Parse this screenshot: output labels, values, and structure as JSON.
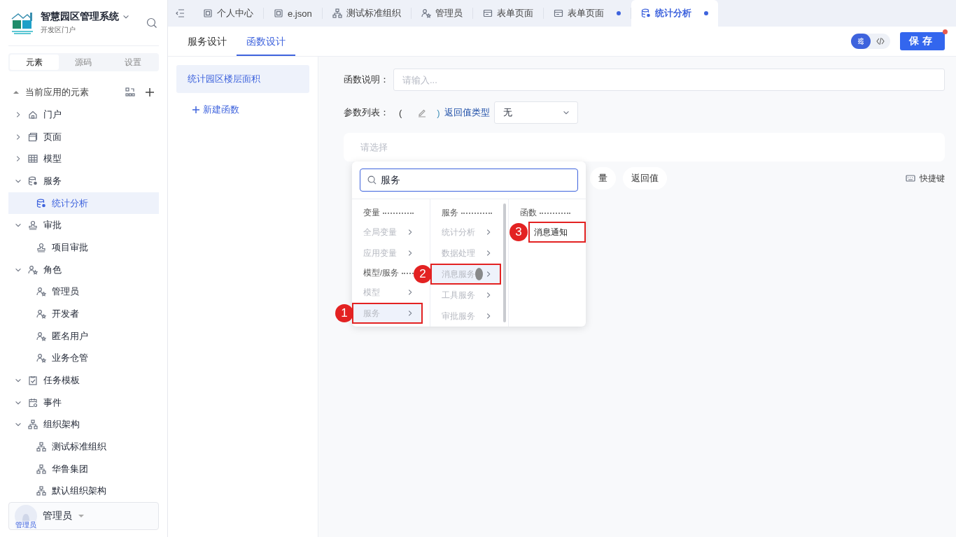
{
  "app": {
    "title": "智慧园区管理系统",
    "subtitle": "开发区门户"
  },
  "sidebar_tabs": [
    {
      "label": "元素",
      "selected": true
    },
    {
      "label": "源码",
      "selected": false
    },
    {
      "label": "设置",
      "selected": false
    }
  ],
  "tree_header": "当前应用的元素",
  "tree": [
    {
      "label": "门户",
      "kind": "home",
      "expanded": false,
      "selected": false
    },
    {
      "label": "页面",
      "kind": "page",
      "expanded": false,
      "selected": false
    },
    {
      "label": "模型",
      "kind": "table",
      "expanded": false,
      "selected": false
    },
    {
      "label": "服务",
      "kind": "service",
      "expanded": true,
      "selected": false,
      "children": [
        {
          "label": "统计分析",
          "kind": "service",
          "selected": true
        }
      ]
    },
    {
      "label": "审批",
      "kind": "stamp",
      "expanded": true,
      "selected": false,
      "children": [
        {
          "label": "项目审批",
          "kind": "stamp",
          "selected": false
        }
      ]
    },
    {
      "label": "角色",
      "kind": "role",
      "expanded": true,
      "selected": false,
      "children": [
        {
          "label": "管理员",
          "kind": "role",
          "selected": false
        },
        {
          "label": "开发者",
          "kind": "role",
          "selected": false
        },
        {
          "label": "匿名用户",
          "kind": "role",
          "selected": false
        },
        {
          "label": "业务仓管",
          "kind": "role",
          "selected": false
        }
      ]
    },
    {
      "label": "任务模板",
      "kind": "task",
      "expanded": true,
      "selected": false
    },
    {
      "label": "事件",
      "kind": "event",
      "expanded": true,
      "selected": false
    },
    {
      "label": "组织架构",
      "kind": "org",
      "expanded": true,
      "selected": false,
      "children": [
        {
          "label": "测试标准组织",
          "kind": "org",
          "selected": false
        },
        {
          "label": "华鲁集团",
          "kind": "org",
          "selected": false
        },
        {
          "label": "默认组织架构",
          "kind": "org",
          "selected": false
        }
      ]
    }
  ],
  "user": {
    "name": "管理员",
    "avatar_label": "管理员"
  },
  "tabs": [
    {
      "label": "个人中心",
      "kind": "doc",
      "selected": false,
      "modified": false
    },
    {
      "label": "e.json",
      "kind": "doc",
      "selected": false,
      "modified": false
    },
    {
      "label": "测试标准组织",
      "kind": "org",
      "selected": false,
      "modified": false
    },
    {
      "label": "管理员",
      "kind": "role",
      "selected": false,
      "modified": false
    },
    {
      "label": "表单页面",
      "kind": "form",
      "selected": false,
      "modified": false
    },
    {
      "label": "表单页面",
      "kind": "form",
      "selected": false,
      "modified": true
    },
    {
      "label": "统计分析",
      "kind": "service",
      "selected": true,
      "modified": true
    }
  ],
  "subtabs": [
    {
      "label": "服务设计",
      "selected": false
    },
    {
      "label": "函数设计",
      "selected": true
    }
  ],
  "view_toggle": [
    {
      "kind": "settings",
      "selected": true
    },
    {
      "kind": "code",
      "selected": false
    }
  ],
  "save_button": {
    "label": "保存",
    "notify": true
  },
  "functions": [
    {
      "label": "统计园区楼层面积",
      "selected": true
    }
  ],
  "new_function": "新建函数",
  "form": {
    "desc_label": "函数说明：",
    "desc_placeholder": "请输入...",
    "params_label": "参数列表：",
    "paren_open": "(",
    "paren_close": ")",
    "return_label": "返回值类型",
    "return_value": "无",
    "expr_placeholder": "请选择"
  },
  "chips": [
    {
      "label": "量"
    },
    {
      "label": "返回值"
    }
  ],
  "shortcut": "快捷键",
  "picker": {
    "search_value": "服务",
    "columns": [
      {
        "items": [
          {
            "kind": "heading",
            "label": "变量"
          },
          {
            "kind": "item",
            "label": "全局变量",
            "disabled": true,
            "selected": false
          },
          {
            "kind": "item",
            "label": "应用变量",
            "disabled": true,
            "selected": false
          },
          {
            "kind": "heading",
            "label": "模型/服务"
          },
          {
            "kind": "item",
            "label": "模型",
            "disabled": true,
            "selected": false
          },
          {
            "kind": "item",
            "label": "服务",
            "disabled": true,
            "selected": true,
            "callout": "1"
          }
        ]
      },
      {
        "items": [
          {
            "kind": "heading",
            "label": "服务"
          },
          {
            "kind": "item",
            "label": "统计分析",
            "disabled": true,
            "selected": false
          },
          {
            "kind": "item",
            "label": "数据处理",
            "disabled": true,
            "selected": false
          },
          {
            "kind": "item",
            "label": "消息服务",
            "disabled": true,
            "selected": true,
            "callout": "2"
          },
          {
            "kind": "item",
            "label": "工具服务",
            "disabled": true,
            "selected": false
          },
          {
            "kind": "item",
            "label": "审批服务",
            "disabled": true,
            "selected": false
          }
        ]
      },
      {
        "items": [
          {
            "kind": "heading",
            "label": "函数"
          },
          {
            "kind": "leaf",
            "label": "消息通知",
            "disabled": false,
            "selected": false,
            "callout": "3"
          }
        ]
      }
    ]
  }
}
